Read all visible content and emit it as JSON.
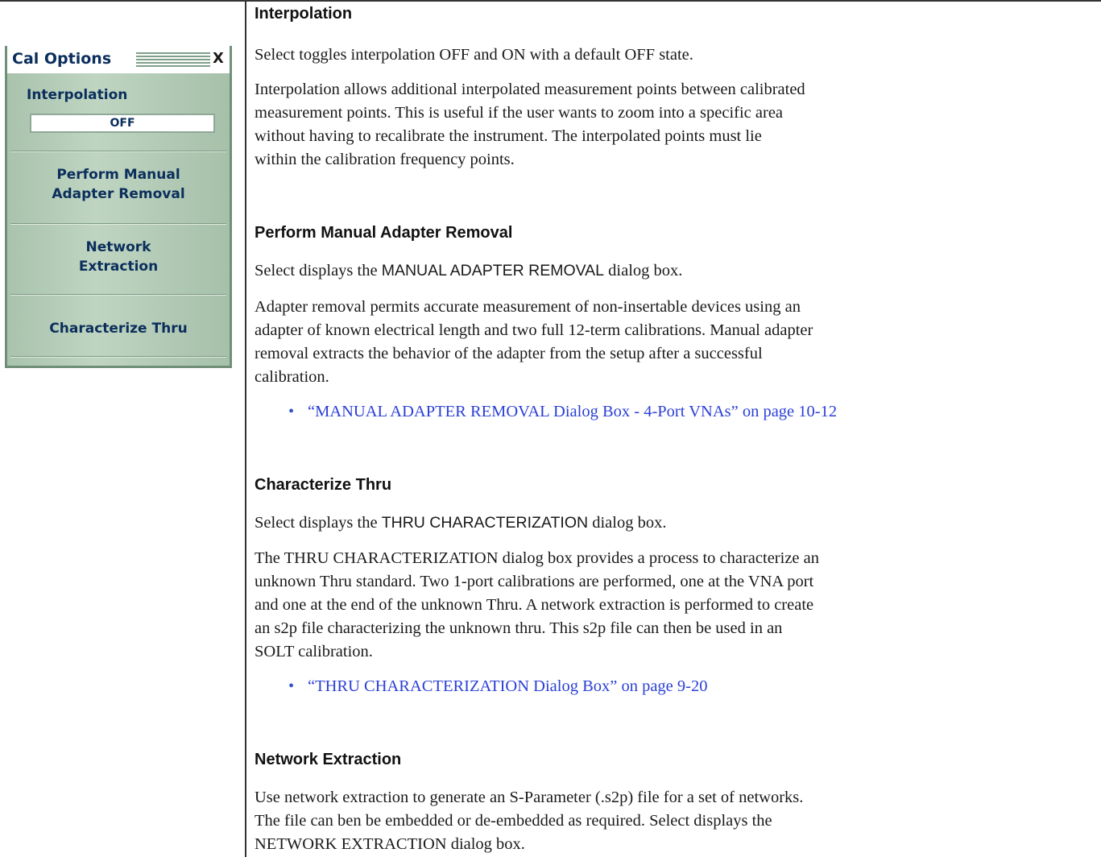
{
  "panel": {
    "title": "Cal Options",
    "close_label": "X",
    "interpolation_label": "Interpolation",
    "interpolation_value": "OFF",
    "items": [
      {
        "line1": "Perform Manual",
        "line2": "Adapter Removal"
      },
      {
        "line1": "Network",
        "line2": "Extraction"
      },
      {
        "line1": "Characterize Thru",
        "line2": ""
      }
    ]
  },
  "doc": {
    "interpolation": {
      "heading": "Interpolation",
      "p1": "Select toggles interpolation OFF and ON with a default OFF state.",
      "p2_lines": [
        "Interpolation allows additional interpolated measurement points between calibrated",
        "measurement points. This is useful if the user wants to zoom into a specific area",
        "without having to recalibrate the instrument. The interpolated points must lie",
        "within the calibration frequency points."
      ]
    },
    "adapter": {
      "heading": "Perform Manual Adapter Removal",
      "p1_prefix": "Select displays the ",
      "p1_name": "MANUAL ADAPTER REMOVAL",
      "p1_suffix": " dialog box.",
      "p2_lines": [
        "Adapter removal permits accurate measurement of non-insertable devices using an",
        "adapter of known electrical length and two full 12-term calibrations. Manual adapter",
        "removal extracts the behavior of the adapter from the setup after a successful",
        "calibration."
      ],
      "bullet": "•",
      "link": "“MANUAL ADAPTER REMOVAL Dialog Box - 4-Port VNAs” on page 10-12"
    },
    "thru": {
      "heading": "Characterize Thru",
      "p1_prefix": "Select displays the ",
      "p1_name": "THRU CHARACTERIZATION",
      "p1_suffix": " dialog box.",
      "p2_lines": [
        "The THRU CHARACTERIZATION dialog box provides a process to characterize an",
        "unknown Thru standard. Two 1-port calibrations are performed, one at the VNA port",
        "and one at the end of the unknown Thru. A network extraction is performed to create",
        "an s2p file characterizing the unknown thru. This s2p file can then be used in an",
        "SOLT calibration."
      ],
      "bullet": "•",
      "link": "“THRU CHARACTERIZATION Dialog Box” on page 9-20"
    },
    "network": {
      "heading": "Network Extraction",
      "p_lines": [
        "Use network extraction to generate an S-Parameter (.s2p) file for a set of networks.",
        "The file can ben be embedded or de-embedded as required. Select displays the",
        "NETWORK EXTRACTION dialog box."
      ]
    }
  }
}
